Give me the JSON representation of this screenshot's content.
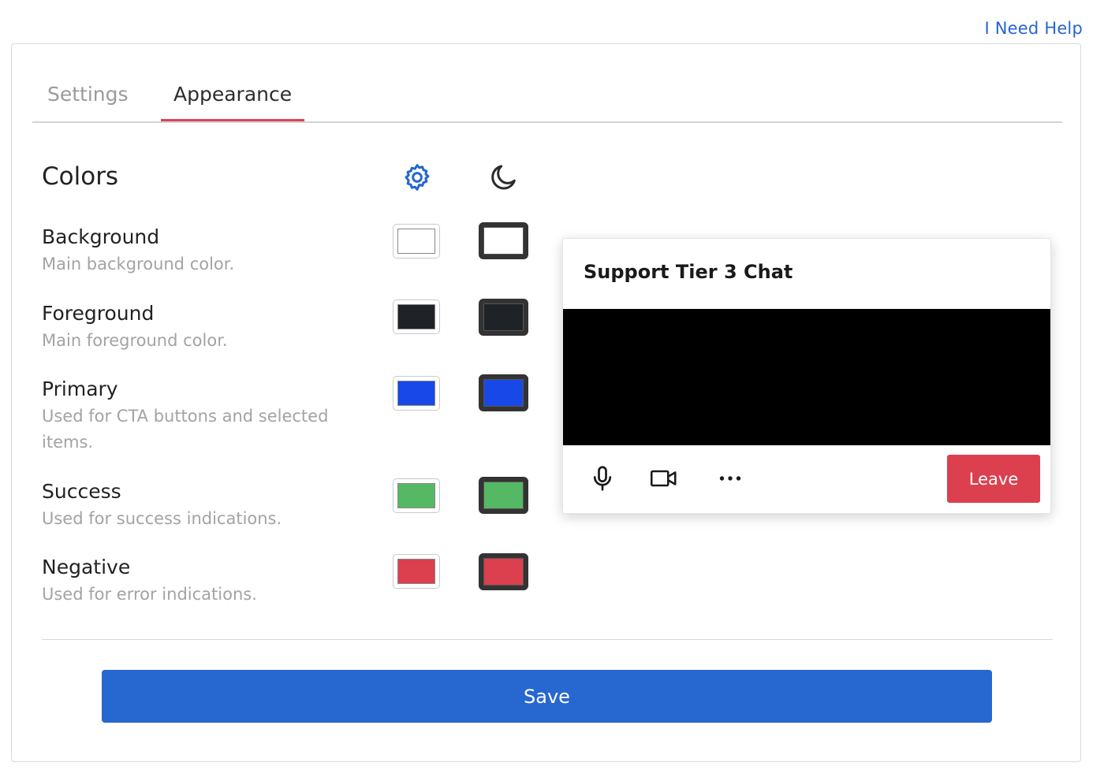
{
  "header": {
    "help_link": "I Need Help"
  },
  "tabs": [
    {
      "label": "Settings",
      "active": false
    },
    {
      "label": "Appearance",
      "active": true
    }
  ],
  "colors_section": {
    "title": "Colors",
    "light_mode_icon": "gear-icon",
    "dark_mode_icon": "moon-icon",
    "rows": [
      {
        "label": "Background",
        "description": "Main background color.",
        "light_color": "#ffffff",
        "dark_color": "#ffffff"
      },
      {
        "label": "Foreground",
        "description": "Main foreground color.",
        "light_color": "#1f2327",
        "dark_color": "#1f2327"
      },
      {
        "label": "Primary",
        "description": "Used for CTA buttons and selected items.",
        "light_color": "#1848e8",
        "dark_color": "#1848e8"
      },
      {
        "label": "Success",
        "description": "Used for success indications.",
        "light_color": "#55b865",
        "dark_color": "#55b865"
      },
      {
        "label": "Negative",
        "description": "Used for error indications.",
        "light_color": "#dc3f4e",
        "dark_color": "#dc3f4e"
      }
    ]
  },
  "preview": {
    "title": "Support Tier 3 Chat",
    "controls": [
      "microphone-icon",
      "video-camera-icon",
      "more-options-icon"
    ],
    "leave_label": "Leave"
  },
  "save_label": "Save",
  "theme": {
    "accent": "#2767d0",
    "tab_underline": "#dc4453",
    "link": "#2566cf"
  }
}
